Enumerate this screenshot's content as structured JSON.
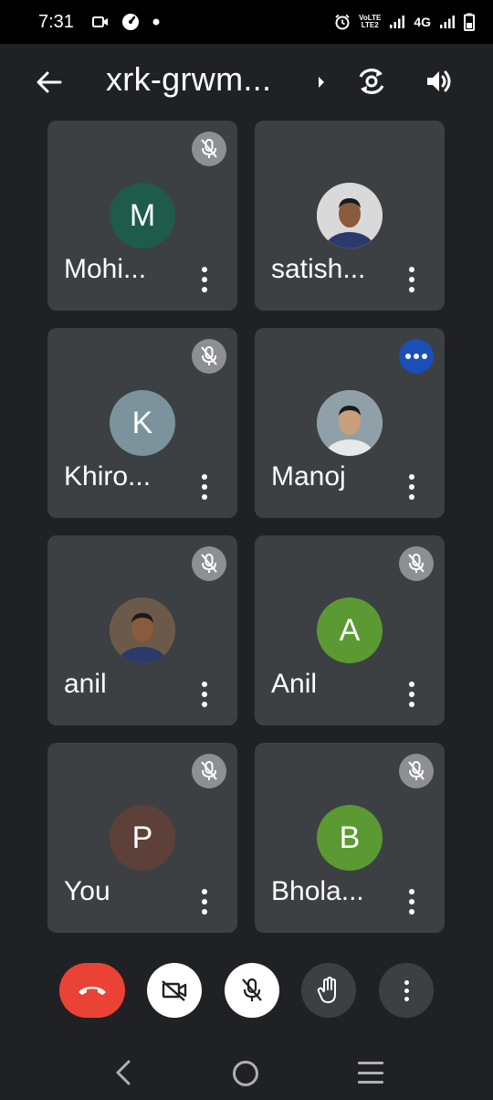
{
  "status_bar": {
    "time": "7:31",
    "volte_top": "VoLTE",
    "volte_bottom": "LTE2",
    "network": "4G",
    "icons": [
      "video-call-icon",
      "data-saver-icon",
      "notification-dot-icon",
      "alarm-icon",
      "volte-icon",
      "signal-icon",
      "signal-icon",
      "battery-icon"
    ]
  },
  "header": {
    "title": "xrk-grwm...",
    "icons": [
      "back-arrow-icon",
      "caret-right-icon",
      "switch-camera-icon",
      "speaker-icon"
    ]
  },
  "participants": [
    {
      "name": "Mohi...",
      "initial": "M",
      "avatar_color": "#1e5b4a",
      "mic": "muted",
      "photo": false
    },
    {
      "name": "satish...",
      "initial": "",
      "avatar_color": "#d9d9d9",
      "mic": "none",
      "photo": true
    },
    {
      "name": "Khiro...",
      "initial": "K",
      "avatar_color": "#7a939c",
      "mic": "muted",
      "photo": false
    },
    {
      "name": "Manoj",
      "initial": "",
      "avatar_color": "#8fa0a8",
      "mic": "speaking",
      "photo": true
    },
    {
      "name": "anil",
      "initial": "",
      "avatar_color": "#6b5a4a",
      "mic": "muted",
      "photo": true
    },
    {
      "name": "Anil",
      "initial": "A",
      "avatar_color": "#5b9a32",
      "mic": "muted",
      "photo": false
    },
    {
      "name": "You",
      "initial": "P",
      "avatar_color": "#5d4037",
      "mic": "muted",
      "photo": false
    },
    {
      "name": "Bhola...",
      "initial": "B",
      "avatar_color": "#5b9a32",
      "mic": "muted",
      "photo": false
    }
  ],
  "controls": [
    "end-call-icon",
    "camera-off-icon",
    "mic-off-icon",
    "raise-hand-icon",
    "more-options-icon"
  ],
  "colors": {
    "background": "#202124",
    "tile": "#3c4043",
    "end_call": "#ea4335",
    "speaking_badge": "#1a4fb8"
  }
}
